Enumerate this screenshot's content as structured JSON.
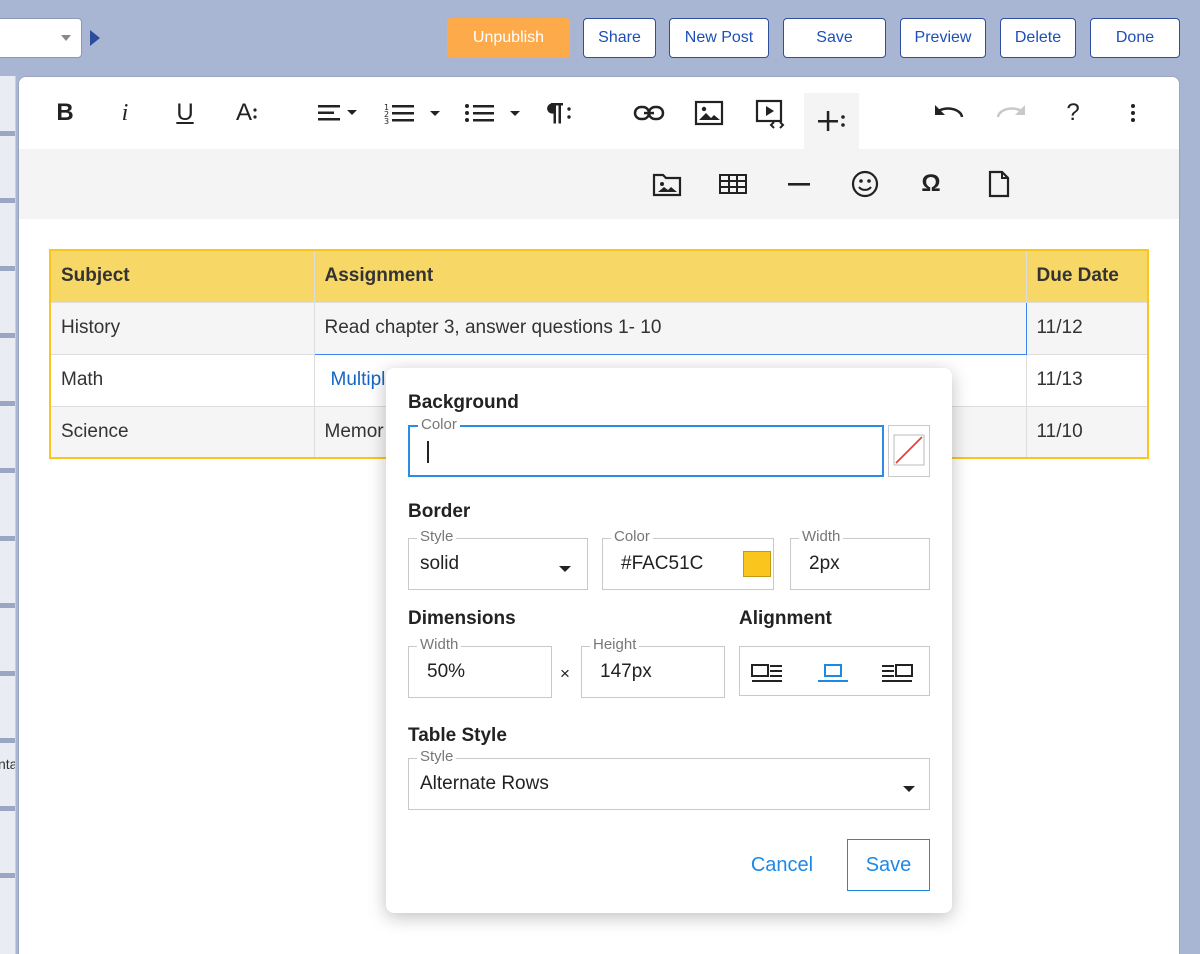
{
  "topbar": {
    "buttons": {
      "unpublish": "Unpublish",
      "share": "Share",
      "new_post": "New Post",
      "save": "Save",
      "preview": "Preview",
      "delete": "Delete",
      "done": "Done"
    }
  },
  "leftstrip": {
    "stub_text": "nta"
  },
  "toolbar": {
    "primary": [
      "bold-icon",
      "italic-icon",
      "underline-icon",
      "font-size-icon",
      "align-icon",
      "ordered-list-icon",
      "unordered-list-icon",
      "paragraph-format-icon",
      "link-icon",
      "image-icon",
      "video-icon",
      "more-insert-icon",
      "undo-icon",
      "redo-icon",
      "help-icon",
      "more-options-icon"
    ],
    "secondary": [
      "file-image-icon",
      "table-icon",
      "horizontal-line-icon",
      "emoticon-icon",
      "special-characters-icon",
      "file-icon"
    ],
    "glyphs": {
      "bold": "B",
      "italic": "i",
      "underline": "U",
      "font_size": "A",
      "help": "?",
      "omega": "Ω"
    }
  },
  "table": {
    "headers": [
      "Subject",
      "Assignment",
      "Due Date"
    ],
    "rows": [
      [
        "History",
        "Read chapter 3, answer questions 1- 10",
        "11/12"
      ],
      [
        "Math",
        "Multipl",
        "11/13"
      ],
      [
        "Science",
        "Memor",
        "11/10"
      ]
    ]
  },
  "popup": {
    "background": {
      "title": "Background",
      "color_label": "Color",
      "color_value": ""
    },
    "border": {
      "title": "Border",
      "style_label": "Style",
      "style_value": "solid",
      "color_label": "Color",
      "color_value": "#FAC51C",
      "width_label": "Width",
      "width_value": "2px"
    },
    "dimensions": {
      "title": "Dimensions",
      "width_label": "Width",
      "width_value": "50%",
      "separator": "×",
      "height_label": "Height",
      "height_value": "147px"
    },
    "alignment": {
      "title": "Alignment",
      "options": [
        "align-left-icon",
        "align-center-icon",
        "align-right-icon"
      ],
      "selected": "align-center-icon"
    },
    "table_style": {
      "title": "Table Style",
      "style_label": "Style",
      "style_value": "Alternate Rows"
    },
    "cancel_label": "Cancel",
    "save_label": "Save"
  },
  "colors": {
    "topbar_bg": "#a9b6d3",
    "unpublish_bg": "#fdaa4b",
    "button_text": "#1d4fb4",
    "table_border": "#fac51c",
    "table_header_bg": "#f7d765",
    "selected_cell_bg": "#d6e1f7",
    "focus_blue": "#2a8be8",
    "link_blue": "#1565c0"
  }
}
